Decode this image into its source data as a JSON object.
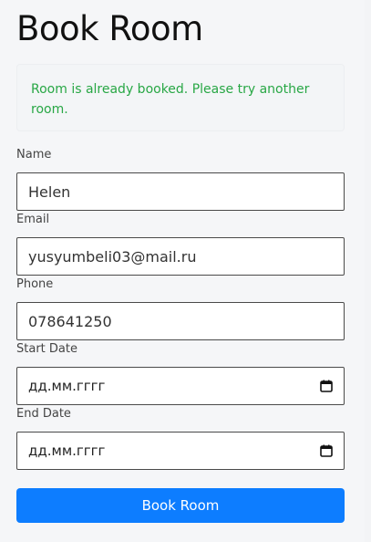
{
  "page": {
    "title": "Book Room"
  },
  "alert": {
    "message": "Room is already booked. Please try another room."
  },
  "form": {
    "name": {
      "label": "Name",
      "value": "Helen"
    },
    "email": {
      "label": "Email",
      "value": "yusyumbeli03@mail.ru"
    },
    "phone": {
      "label": "Phone",
      "value": "078641250"
    },
    "start_date": {
      "label": "Start Date",
      "placeholder": "дд.мм.гггг",
      "icon": "calendar-icon"
    },
    "end_date": {
      "label": "End Date",
      "placeholder": "дд.мм.гггг",
      "icon": "calendar-icon"
    },
    "submit_label": "Book Room"
  },
  "colors": {
    "primary": "#0d7dff",
    "success_text": "#28a745",
    "alert_bg": "#f3f5f7"
  }
}
